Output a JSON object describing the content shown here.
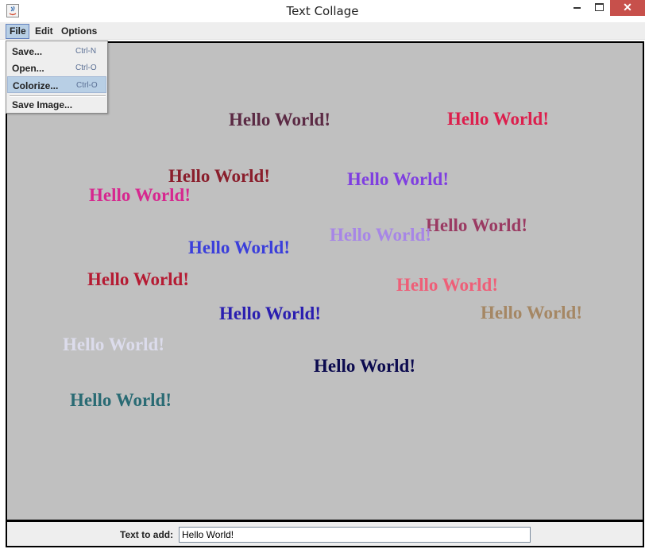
{
  "window": {
    "title": "Text Collage",
    "close_glyph": "✕"
  },
  "menubar": {
    "items": [
      "File",
      "Edit",
      "Options"
    ]
  },
  "file_menu": {
    "items": [
      {
        "label": "Save...",
        "accelerator": "Ctrl-N"
      },
      {
        "label": "Open...",
        "accelerator": "Ctrl-O"
      },
      {
        "label": "Colorize...",
        "accelerator": "Ctrl-O"
      },
      {
        "label": "Save Image...",
        "accelerator": ""
      }
    ],
    "highlighted_index": 2
  },
  "canvas": {
    "background": "#c0c0c0",
    "words": [
      {
        "text": "Hello World!",
        "color": "#5b2a44"
      },
      {
        "text": "Hello World!",
        "color": "#dc1f4d"
      },
      {
        "text": "Hello World!",
        "color": "#8a1e2c"
      },
      {
        "text": "Hello World!",
        "color": "#7f3fe0"
      },
      {
        "text": "Hello World!",
        "color": "#d6288f"
      },
      {
        "text": "Hello World!",
        "color": "#9a3a62"
      },
      {
        "text": "Hello World!",
        "color": "#a786e6"
      },
      {
        "text": "Hello World!",
        "color": "#3a3edb"
      },
      {
        "text": "Hello World!",
        "color": "#b51b33"
      },
      {
        "text": "Hello World!",
        "color": "#ee5f78"
      },
      {
        "text": "Hello World!",
        "color": "#2a1eb0"
      },
      {
        "text": "Hello World!",
        "color": "#a58764"
      },
      {
        "text": "Hello World!",
        "color": "#dcdcec"
      },
      {
        "text": "Hello World!",
        "color": "#0c0b4f"
      },
      {
        "text": "Hello World!",
        "color": "#2a6b74"
      }
    ]
  },
  "bottom": {
    "label": "Text to add:",
    "input_value": "Hello World!"
  }
}
